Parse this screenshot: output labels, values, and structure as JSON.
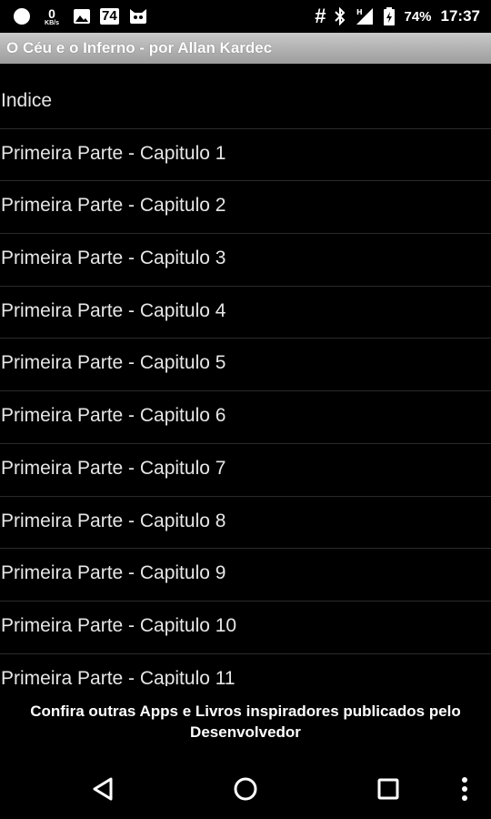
{
  "status_bar": {
    "speed_value": "0",
    "speed_unit": "KB/s",
    "badge_number": "74",
    "battery_percent": "74%",
    "time": "17:37"
  },
  "app": {
    "title": "O Céu e o Inferno - por Allan Kardec"
  },
  "list": {
    "items": [
      {
        "label": "Indice"
      },
      {
        "label": "Primeira Parte - Capitulo 1"
      },
      {
        "label": "Primeira Parte - Capitulo 2"
      },
      {
        "label": "Primeira Parte - Capitulo 3"
      },
      {
        "label": "Primeira Parte - Capitulo 4"
      },
      {
        "label": "Primeira Parte - Capitulo 5"
      },
      {
        "label": "Primeira Parte - Capitulo 6"
      },
      {
        "label": "Primeira Parte - Capitulo 7"
      },
      {
        "label": "Primeira Parte - Capitulo 8"
      },
      {
        "label": "Primeira Parte - Capitulo 9"
      },
      {
        "label": "Primeira Parte - Capitulo 10"
      },
      {
        "label": "Primeira Parte - Capitulo 11"
      }
    ]
  },
  "footer": {
    "banner_text": "Confira outras Apps e Livros inspiradores publicados pelo Desenvolvedor"
  },
  "icons": {
    "status_left": [
      "circle-notification-icon",
      "network-speed-icon",
      "image-icon",
      "badge-icon",
      "cat-icon"
    ],
    "status_right": [
      "hash-icon",
      "bluetooth-icon",
      "signal-icon",
      "battery-icon"
    ],
    "nav": [
      "back-icon",
      "home-icon",
      "recents-icon",
      "overflow-menu-icon"
    ]
  },
  "colors": {
    "background": "#000000",
    "title_bar": "#b3b3b3",
    "text": "#ffffff",
    "divider": "#2a2a2a"
  }
}
